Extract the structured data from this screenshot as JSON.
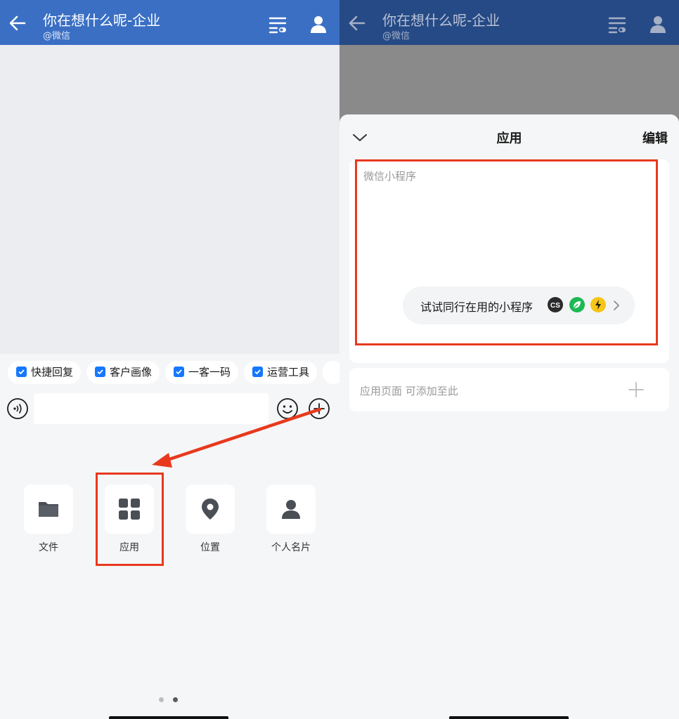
{
  "colors": {
    "header_blue": "#3a6fc4",
    "header_dim": "#264a85",
    "checkbox_blue": "#1677ff",
    "annotation_red": "#e8391e"
  },
  "left": {
    "header": {
      "title": "你在想什么呢-企业",
      "subtitle": "@微信",
      "back_icon": "arrow-left-icon",
      "filter_icon": "filter-toggle-icon",
      "contact_icon": "person-icon"
    },
    "chips": [
      {
        "label": "快捷回复"
      },
      {
        "label": "客户画像"
      },
      {
        "label": "一客一码"
      },
      {
        "label": "运营工具"
      }
    ],
    "input": {
      "value": "",
      "voice_icon": "voice-icon",
      "emoji_icon": "emoji-icon",
      "plus_icon": "plus-circle-icon"
    },
    "tiles": [
      {
        "label": "文件",
        "icon": "folder-icon"
      },
      {
        "label": "应用",
        "icon": "grid-apps-icon"
      },
      {
        "label": "位置",
        "icon": "location-pin-icon"
      },
      {
        "label": "个人名片",
        "icon": "person-card-icon"
      }
    ],
    "page_indicator": {
      "count": 2,
      "active": 1
    }
  },
  "right": {
    "header": {
      "title": "你在想什么呢-企业",
      "subtitle": "@微信"
    },
    "sheet": {
      "title": "应用",
      "edit_label": "编辑",
      "collapse_icon": "chevron-down-icon",
      "mini_program_label": "微信小程序",
      "try_text": "试试同行在用的小程序",
      "mini_icons": [
        {
          "name": "cs-icon",
          "text": "CS",
          "color": "#2b2b2b"
        },
        {
          "name": "leaf-icon",
          "text": "",
          "color": "#1db954"
        },
        {
          "name": "bolt-icon",
          "text": "",
          "color": "#f5c518"
        }
      ],
      "app_page_text": "应用页面 可添加至此",
      "add_icon": "plus-icon"
    }
  }
}
